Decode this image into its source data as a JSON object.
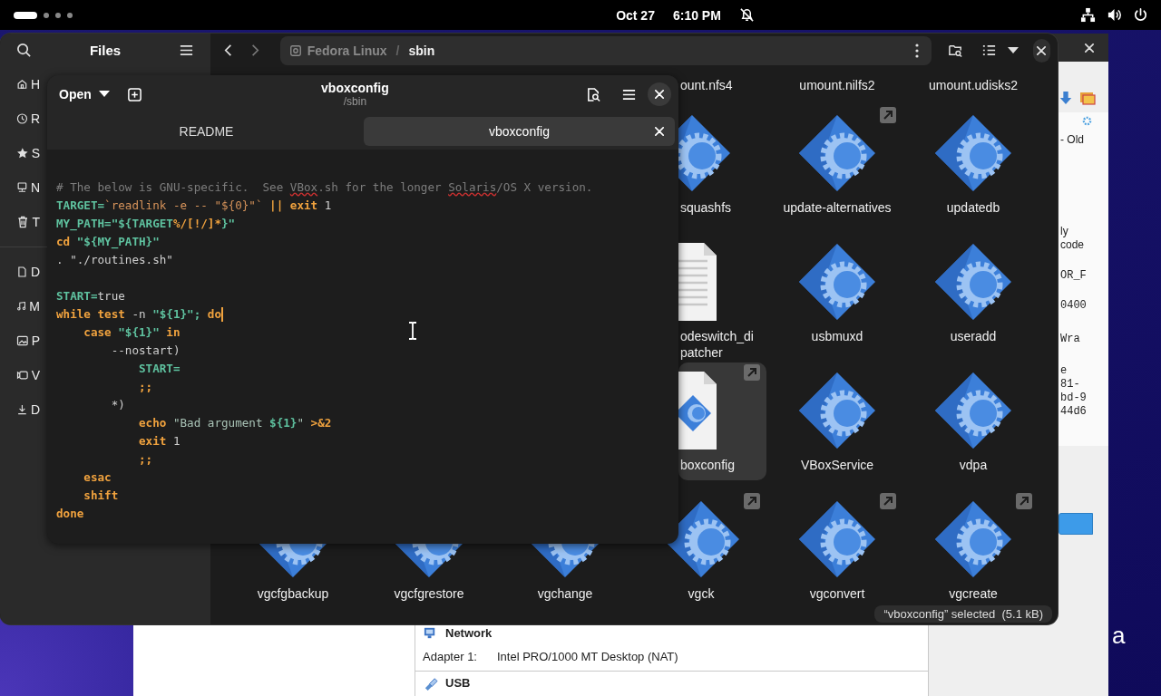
{
  "top_bar": {
    "date": "Oct 27",
    "time": "6:10 PM"
  },
  "wallpaper_text": "a",
  "vbox": {
    "network_title": "Network",
    "adapter_label": "Adapter 1:",
    "adapter_value": "Intel PRO/1000 MT Desktop (NAT)",
    "usb_title": "USB",
    "fragments": [
      [
        "- Old"
      ],
      [
        "ly",
        "code"
      ],
      [
        "OR_F"
      ],
      [
        "0400"
      ],
      [
        "Wra"
      ],
      [
        "e",
        "81-",
        "bd-9",
        "44d6"
      ]
    ]
  },
  "files": {
    "title": "Files",
    "sidebar": [
      {
        "items": [
          {
            "label": "H",
            "kind": "home"
          },
          {
            "label": "R",
            "kind": "recent"
          },
          {
            "label": "S",
            "kind": "star"
          },
          {
            "label": "N",
            "kind": "network"
          },
          {
            "label": "T",
            "kind": "trash"
          }
        ]
      },
      {
        "items": [
          {
            "label": "D",
            "kind": "document"
          },
          {
            "label": "M",
            "kind": "music"
          },
          {
            "label": "P",
            "kind": "picture"
          },
          {
            "label": "V",
            "kind": "video"
          },
          {
            "label": "D",
            "kind": "download"
          }
        ]
      }
    ],
    "path": {
      "separator": "/",
      "crumbs": [
        {
          "label": "Fedora Linux",
          "selected": false
        },
        {
          "label": "sbin",
          "selected": true
        }
      ]
    },
    "rows": [
      {
        "items": [
          {
            "label": "ount.nfs4",
            "link": false,
            "selected": false
          },
          {
            "label": "umount.nilfs2",
            "link": false,
            "selected": false
          },
          {
            "label": "umount.udisks2",
            "link": false,
            "selected": false
          }
        ]
      },
      {
        "items": [
          {
            "label": "squashfs",
            "kind": "executable",
            "link": false,
            "selected": false
          },
          {
            "label": "update-alternatives",
            "kind": "executable",
            "link": true,
            "selected": false
          },
          {
            "label": "updatedb",
            "kind": "executable",
            "link": false,
            "selected": false
          }
        ]
      },
      {
        "items": [
          {
            "label": "odeswitch_di\npatcher",
            "kind": "text",
            "link": false,
            "selected": false
          },
          {
            "label": "usbmuxd",
            "kind": "executable",
            "link": false,
            "selected": false
          },
          {
            "label": "useradd",
            "kind": "executable",
            "link": false,
            "selected": false
          }
        ]
      },
      {
        "items": [
          {
            "label": "boxconfig",
            "kind": "script",
            "link": true,
            "selected": true
          },
          {
            "label": "VBoxService",
            "kind": "executable",
            "link": false,
            "selected": false
          },
          {
            "label": "vdpa",
            "kind": "executable",
            "link": false,
            "selected": false
          }
        ]
      },
      {
        "items": [
          {
            "label": "vgcfgbackup",
            "kind": "executable",
            "link": false,
            "selected": false
          },
          {
            "label": "vgcfgrestore",
            "kind": "executable",
            "link": false,
            "selected": false
          },
          {
            "label": "vgchange",
            "kind": "executable",
            "link": false,
            "selected": false
          },
          {
            "label": "vgck",
            "kind": "executable",
            "link": true,
            "selected": false
          },
          {
            "label": "vgconvert",
            "kind": "executable",
            "link": true,
            "selected": false
          },
          {
            "label": "vgcreate",
            "kind": "executable",
            "link": true,
            "selected": false
          }
        ]
      }
    ],
    "status": "“vboxconfig” selected  (5.1 kB)"
  },
  "editor": {
    "open_label": "Open",
    "title": "vboxconfig",
    "subtitle": "/sbin",
    "tabs": [
      {
        "label": "README",
        "selected": false
      },
      {
        "label": "vboxconfig",
        "selected": true
      }
    ],
    "lines": [
      {
        "kind": "code",
        "cursor": false,
        "segments": [
          {
            "text": "# The below is GNU-specific.  See ",
            "kind": "comment"
          },
          {
            "text": "VBox",
            "kind": "spell"
          },
          {
            "text": ".sh for the longer ",
            "kind": "comment"
          },
          {
            "text": "Solaris",
            "kind": "spell"
          },
          {
            "text": "/OS X version.",
            "kind": "comment"
          }
        ]
      },
      {
        "kind": "code",
        "cursor": false,
        "segments": [
          {
            "text": "TARGET=",
            "kind": "var"
          },
          {
            "text": "`readlink -e -- \"${0}\"`",
            "kind": "backtick"
          },
          {
            "text": " || exit",
            "kind": "keyword"
          },
          {
            "text": " 1",
            "kind": "plain"
          }
        ]
      },
      {
        "kind": "code",
        "cursor": false,
        "segments": [
          {
            "text": "MY_PATH=\"${TARGET",
            "kind": "var"
          },
          {
            "text": "%/[!/]*",
            "kind": "keyword"
          },
          {
            "text": "}\"",
            "kind": "var"
          }
        ]
      },
      {
        "kind": "code",
        "cursor": false,
        "segments": [
          {
            "text": "cd",
            "kind": "keyword"
          },
          {
            "text": " \"${MY_PATH}\"",
            "kind": "var"
          }
        ]
      },
      {
        "kind": "code",
        "cursor": false,
        "segments": [
          {
            "text": ". \"./routines.sh\"",
            "kind": "plain"
          }
        ]
      },
      {
        "kind": "blank"
      },
      {
        "kind": "code",
        "cursor": false,
        "segments": [
          {
            "text": "START=",
            "kind": "var"
          },
          {
            "text": "true",
            "kind": "plain"
          }
        ]
      },
      {
        "kind": "code",
        "cursor": true,
        "segments": [
          {
            "text": "while test",
            "kind": "keyword"
          },
          {
            "text": " -n ",
            "kind": "plain"
          },
          {
            "text": "\"${1}\";",
            "kind": "var"
          },
          {
            "text": " do",
            "kind": "keyword"
          }
        ]
      },
      {
        "kind": "code",
        "cursor": false,
        "segments": [
          {
            "text": "    case",
            "kind": "keyword"
          },
          {
            "text": " \"${1}\"",
            "kind": "var"
          },
          {
            "text": " in",
            "kind": "keyword"
          }
        ]
      },
      {
        "kind": "code",
        "cursor": false,
        "segments": [
          {
            "text": "        --nostart)",
            "kind": "plain"
          }
        ]
      },
      {
        "kind": "code",
        "cursor": false,
        "segments": [
          {
            "text": "            START=",
            "kind": "var"
          }
        ]
      },
      {
        "kind": "code",
        "cursor": false,
        "segments": [
          {
            "text": "            ;;",
            "kind": "keyword"
          }
        ]
      },
      {
        "kind": "code",
        "cursor": false,
        "segments": [
          {
            "text": "        *)",
            "kind": "plain"
          }
        ]
      },
      {
        "kind": "code",
        "cursor": false,
        "segments": [
          {
            "text": "            echo",
            "kind": "keyword"
          },
          {
            "text": " \"Bad argument ",
            "kind": "string"
          },
          {
            "text": "${1}",
            "kind": "var"
          },
          {
            "text": "\"",
            "kind": "string"
          },
          {
            "text": " >&2",
            "kind": "keyword"
          }
        ]
      },
      {
        "kind": "code",
        "cursor": false,
        "segments": [
          {
            "text": "            exit",
            "kind": "keyword"
          },
          {
            "text": " 1",
            "kind": "plain"
          }
        ]
      },
      {
        "kind": "code",
        "cursor": false,
        "segments": [
          {
            "text": "            ;;",
            "kind": "keyword"
          }
        ]
      },
      {
        "kind": "code",
        "cursor": false,
        "segments": [
          {
            "text": "    esac",
            "kind": "keyword"
          }
        ]
      },
      {
        "kind": "code",
        "cursor": false,
        "segments": [
          {
            "text": "    shift",
            "kind": "keyword"
          }
        ]
      },
      {
        "kind": "code",
        "cursor": false,
        "segments": [
          {
            "text": "done",
            "kind": "keyword"
          }
        ]
      }
    ]
  }
}
